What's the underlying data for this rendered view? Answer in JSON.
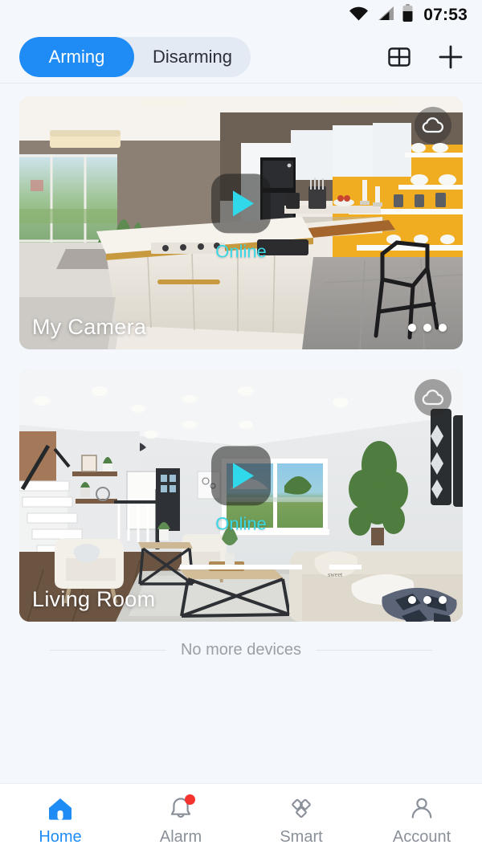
{
  "status_bar": {
    "time": "07:53",
    "wifi_icon": "wifi-icon",
    "signal_icon": "cellular-signal-icon",
    "battery_icon": "battery-icon"
  },
  "header": {
    "segments": [
      {
        "label": "Arming",
        "active": true
      },
      {
        "label": "Disarming",
        "active": false
      }
    ],
    "grid_icon": "grid-layout-icon",
    "add_icon": "plus-icon",
    "accent_color": "#1f8cf5",
    "segment_track_color": "#e3eaf4"
  },
  "devices": [
    {
      "name": "My Camera",
      "status": "Online",
      "status_color": "#3ad7e6",
      "cloud_icon": "cloud-icon",
      "play_icon": "play-icon",
      "more_icon": "more-options-icon",
      "scene": "kitchen"
    },
    {
      "name": "Living Room",
      "status": "Online",
      "status_color": "#3ad7e6",
      "cloud_icon": "cloud-icon",
      "play_icon": "play-icon",
      "more_icon": "more-options-icon",
      "scene": "living-room"
    }
  ],
  "list_footer": {
    "text": "No more devices"
  },
  "tabbar": {
    "items": [
      {
        "label": "Home",
        "icon": "home-icon",
        "active": true,
        "badge": false
      },
      {
        "label": "Alarm",
        "icon": "bell-icon",
        "active": false,
        "badge": true
      },
      {
        "label": "Smart",
        "icon": "diamonds-icon",
        "active": false,
        "badge": false
      },
      {
        "label": "Account",
        "icon": "person-icon",
        "active": false,
        "badge": false
      }
    ],
    "active_color": "#1f8cf5",
    "inactive_color": "#8a9099",
    "badge_color": "#f5332e"
  }
}
